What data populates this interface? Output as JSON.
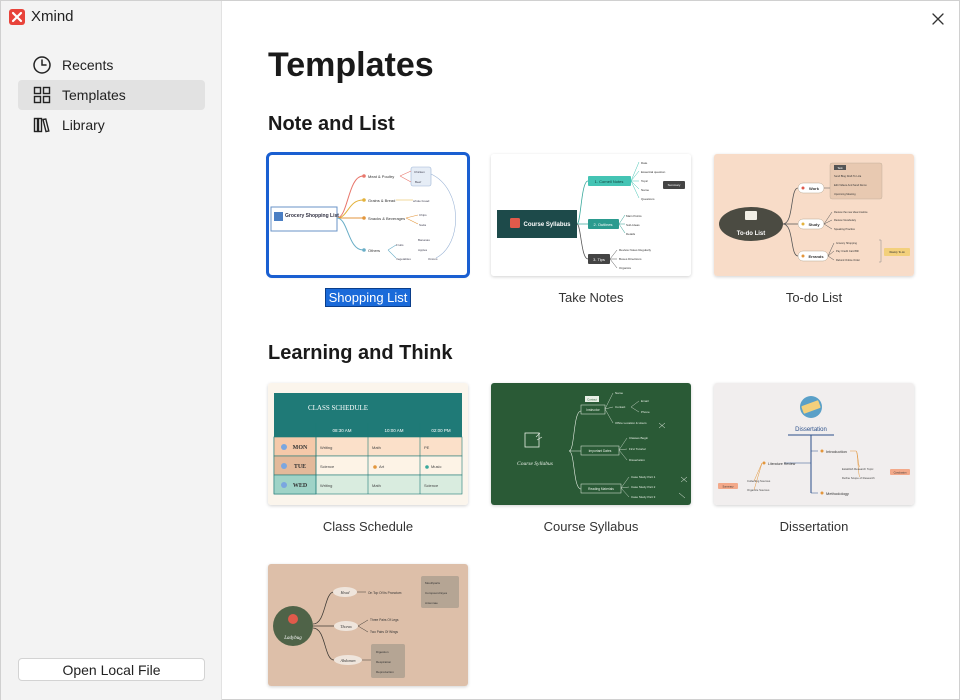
{
  "app": {
    "title": "Xmind",
    "colors": {
      "accent": "#1a6ad9",
      "logo": "#e8433a"
    }
  },
  "sidebar": {
    "items": [
      {
        "label": "Recents",
        "icon": "clock-icon"
      },
      {
        "label": "Templates",
        "icon": "grid-icon",
        "active": true
      },
      {
        "label": "Library",
        "icon": "books-icon"
      }
    ],
    "open_local_label": "Open Local File"
  },
  "main": {
    "title": "Templates",
    "sections": [
      {
        "title": "Note and List",
        "templates": [
          {
            "label": "Shopping List",
            "selected": true,
            "preview": {
              "root": "Grocery Shopping List",
              "branches": [
                "Meat & Poultry",
                "Grains & Bread",
                "Snacks & Beverages",
                "Others"
              ],
              "leaves": [
                "Chicken",
                "Beef",
                "whole bread",
                "Chips",
                "Soda",
                "Fruits",
                "Bananas",
                "Apples",
                "Vegetables",
                "Onions"
              ]
            }
          },
          {
            "label": "Take Notes",
            "preview": {
              "root": "TAKE NOTES",
              "branches": [
                "1. Cornell Notes",
                "2. Outlines",
                "3. Tips"
              ],
              "leaves": [
                "Date",
                "Essential question",
                "Topic",
                "Name",
                "Questions",
                "Summary",
                "Main Points",
                "Sub-Ideas",
                "Details",
                "Review Notes Regularly",
                "Boxes Directions",
                "Organize"
              ]
            }
          },
          {
            "label": "To-do List",
            "preview": {
              "root": "To-do List",
              "branches": [
                "Work",
                "Study",
                "Errands"
              ],
              "leaves": [
                "Send Blog Draft To Liza",
                "Edit Videos And Send Demo",
                "Upcoming Meeting",
                "Review the new idea timeline",
                "Review Vocabulary",
                "Speaking Practice",
                "Grocery Shopping",
                "Pay Credit Card Bill",
                "Refund Online Order",
                "Weekly To-do",
                "Task"
              ]
            }
          }
        ]
      },
      {
        "title": "Learning and Think",
        "templates": [
          {
            "label": "Class Schedule",
            "preview": {
              "header": "CLASS SCHEDULE",
              "times": [
                "08:30 AM",
                "10:00 AM",
                "02:00 PM"
              ],
              "rows": [
                {
                  "day": "MON",
                  "cells": [
                    "Writing",
                    "Math",
                    "PE"
                  ]
                },
                {
                  "day": "TUE",
                  "cells": [
                    "Science",
                    "Art",
                    "Music"
                  ]
                },
                {
                  "day": "WED",
                  "cells": [
                    "Writing",
                    "Math",
                    "Science"
                  ]
                }
              ]
            }
          },
          {
            "label": "Course Syllabus",
            "preview": {
              "root": "Course Syllabus",
              "branches": [
                "Instructor",
                "Important Dates",
                "Reading Materials"
              ],
              "leaves": [
                "Contact",
                "Name",
                "Email",
                "Phone",
                "Office Location & Hours",
                "Classes Begin",
                "First Tutorial",
                "Dissertation",
                "Case Study Part 1",
                "Case Study Part 2",
                "Case Study Part 3"
              ]
            }
          },
          {
            "label": "Dissertation",
            "preview": {
              "root": "Dissertation",
              "branches": [
                "Introduction",
                "Literature Review",
                "Methodology"
              ],
              "leaves": [
                "Establish Research Topic",
                "Define Scope of Research",
                "Collecting Sources",
                "Organize Sources",
                "Summary",
                "Conclusion"
              ]
            }
          },
          {
            "label": "",
            "preview": {
              "root": "Ladybug",
              "branches": [
                "Head",
                "Thorax",
                "Abdomen"
              ],
              "leaves": [
                "On Top Of Its Pronotum",
                "Mouthparts",
                "Compound Eyes",
                "Antennae",
                "Three Pairs Of Legs",
                "Two Pairs Of Wings",
                "Digestion",
                "Respiration",
                "Reproduction"
              ]
            }
          }
        ]
      }
    ]
  }
}
